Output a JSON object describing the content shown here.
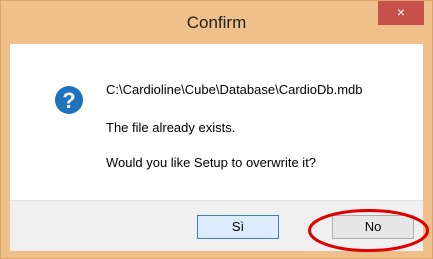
{
  "dialog": {
    "title": "Confirm",
    "close_glyph": "×",
    "icon": "question-icon",
    "path": "C:\\Cardioline\\Cube\\Database\\CardioDb.mdb",
    "exists_text": "The file already exists.",
    "question_text": "Would you like Setup to overwrite it?",
    "yes_label": "Sì",
    "no_label": "No"
  },
  "colors": {
    "titlebar": "#f0c08a",
    "close_button": "#c8504a",
    "icon": "#1e73be",
    "annotation": "#e00000"
  }
}
